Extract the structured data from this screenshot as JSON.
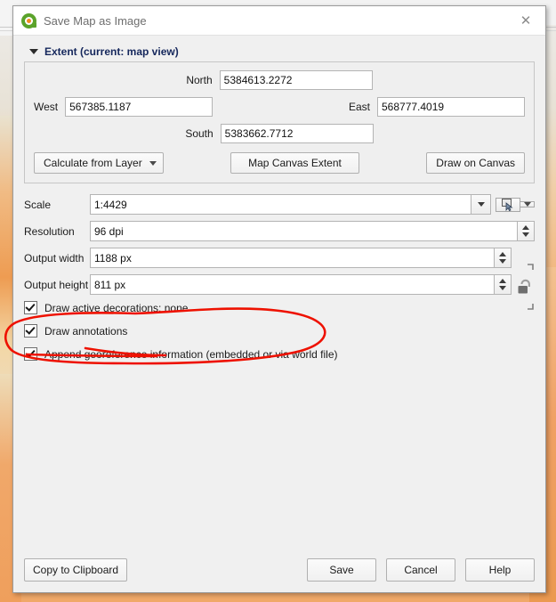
{
  "window": {
    "title": "Save Map as Image",
    "logo_icon": "qgis-logo-icon",
    "close_icon": "✕"
  },
  "extent": {
    "group_title": "Extent (current: map view)",
    "collapse_icon": "triangle-down-icon",
    "north_label": "North",
    "north_value": "5384613.2272",
    "west_label": "West",
    "west_value": "567385.1187",
    "east_label": "East",
    "east_value": "568777.4019",
    "south_label": "South",
    "south_value": "5383662.7712",
    "calculate_from_layer": "Calculate from Layer",
    "map_canvas_extent": "Map Canvas Extent",
    "draw_on_canvas": "Draw on Canvas"
  },
  "settings": {
    "scale_label": "Scale",
    "scale_value": "1:4429",
    "scale_canvas_icon": "set-to-canvas-scale-icon",
    "resolution_label": "Resolution",
    "resolution_value": "96 dpi",
    "output_width_label": "Output width",
    "output_width_value": "1188 px",
    "output_height_label": "Output height",
    "output_height_value": "811 px",
    "lock_icon": "padlock-open-icon"
  },
  "options": [
    {
      "label": "Draw active decorations: none",
      "checked": true
    },
    {
      "label": "Draw annotations",
      "checked": true
    },
    {
      "label": "Append georeference information (embedded or via world file)",
      "checked": true
    }
  ],
  "footer": {
    "copy_to_clipboard": "Copy to Clipboard",
    "save": "Save",
    "cancel": "Cancel",
    "help": "Help"
  },
  "annotation": {
    "type": "hand-drawn-ellipse",
    "color": "#ee1100",
    "target": "Append georeference information (embedded or via world file)"
  }
}
